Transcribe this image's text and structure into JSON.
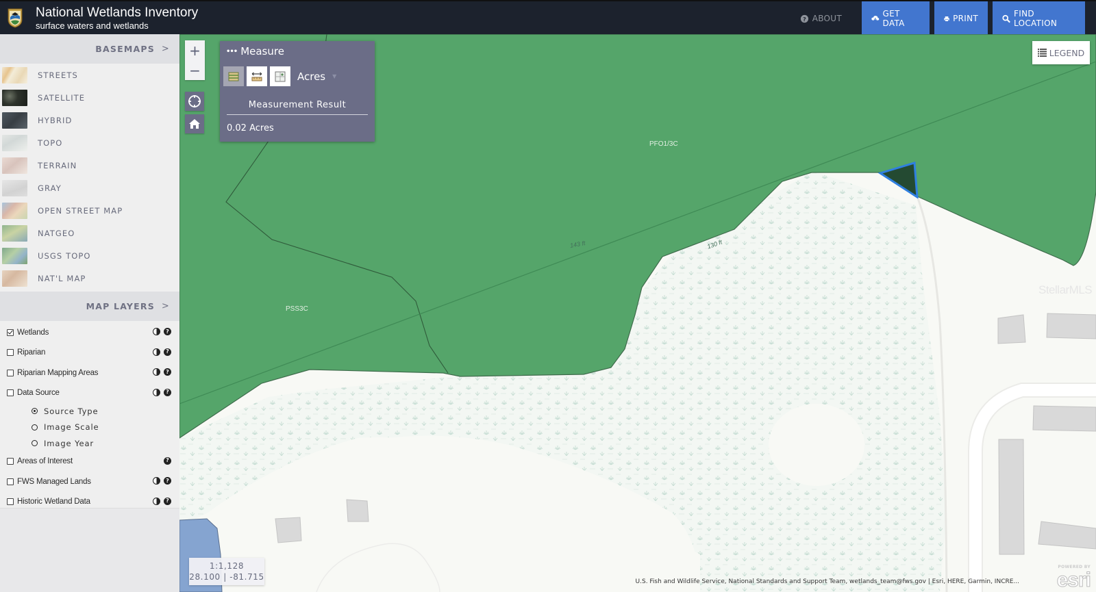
{
  "header": {
    "title": "National Wetlands Inventory",
    "subtitle": "surface waters and wetlands",
    "nav": [
      {
        "label": "ABOUT",
        "icon": "question-circle-icon"
      },
      {
        "label": "GET DATA",
        "icon": "cloud-download-icon"
      },
      {
        "label": "PRINT",
        "icon": "print-icon"
      },
      {
        "label": "FIND LOCATION",
        "icon": "search-icon"
      }
    ]
  },
  "colors": {
    "header_bg": "#1c222d",
    "nav_blue": "#4276cf",
    "panel": "#6b6d87",
    "wetland_green": "#55a56a",
    "selection_blue": "#2f7fe0"
  },
  "sidebar": {
    "basemaps_title": "BASEMAPS",
    "basemaps": [
      {
        "label": "STREETS"
      },
      {
        "label": "SATELLITE"
      },
      {
        "label": "HYBRID"
      },
      {
        "label": "TOPO"
      },
      {
        "label": "TERRAIN"
      },
      {
        "label": "GRAY"
      },
      {
        "label": "OPEN STREET MAP"
      },
      {
        "label": "NATGEO"
      },
      {
        "label": "USGS TOPO"
      },
      {
        "label": "NAT'L MAP"
      }
    ],
    "layers_title": "MAP LAYERS",
    "layers": [
      {
        "label": "Wetlands",
        "checked": true,
        "opacity_icon": true,
        "help_icon": true
      },
      {
        "label": "Riparian",
        "checked": false,
        "opacity_icon": true,
        "help_icon": true
      },
      {
        "label": "Riparian Mapping Areas",
        "checked": false,
        "opacity_icon": true,
        "help_icon": true
      },
      {
        "label": "Data Source",
        "checked": false,
        "opacity_icon": true,
        "help_icon": true
      },
      {
        "label": "Areas of Interest",
        "checked": false,
        "opacity_icon": false,
        "help_icon": true
      },
      {
        "label": "FWS Managed Lands",
        "checked": false,
        "opacity_icon": true,
        "help_icon": true
      },
      {
        "label": "Historic Wetland Data",
        "checked": false,
        "opacity_icon": true,
        "help_icon": true
      }
    ],
    "data_source_options": [
      {
        "label": "Source Type",
        "selected": true
      },
      {
        "label": "Image Scale",
        "selected": false
      },
      {
        "label": "Image Year",
        "selected": false
      }
    ]
  },
  "map": {
    "labels": {
      "pfo": "PFO1/3C",
      "pss": "PSS3C"
    },
    "distances": {
      "d1": "143 ft",
      "d2": "130 ft"
    },
    "watermark": "StellarMLS",
    "legend_label": "LEGEND",
    "zoom_in": "+",
    "zoom_out": "−",
    "scale": "1:1,128",
    "coordinates": "28.100 | -81.715",
    "attribution": "U.S. Fish and Wildlife Service, National Standards and Support Team, wetlands_team@fws.gov | Esri, HERE, Garmin, INCRE...",
    "esri_powered": "POWERED BY",
    "esri_logo": "esri"
  },
  "measure": {
    "title": "Measure",
    "tools": [
      {
        "name": "area",
        "active": true
      },
      {
        "name": "distance",
        "active": false
      },
      {
        "name": "location",
        "active": false
      }
    ],
    "unit": "Acres",
    "result_heading": "Measurement Result",
    "result_value": "0.02 Acres"
  }
}
